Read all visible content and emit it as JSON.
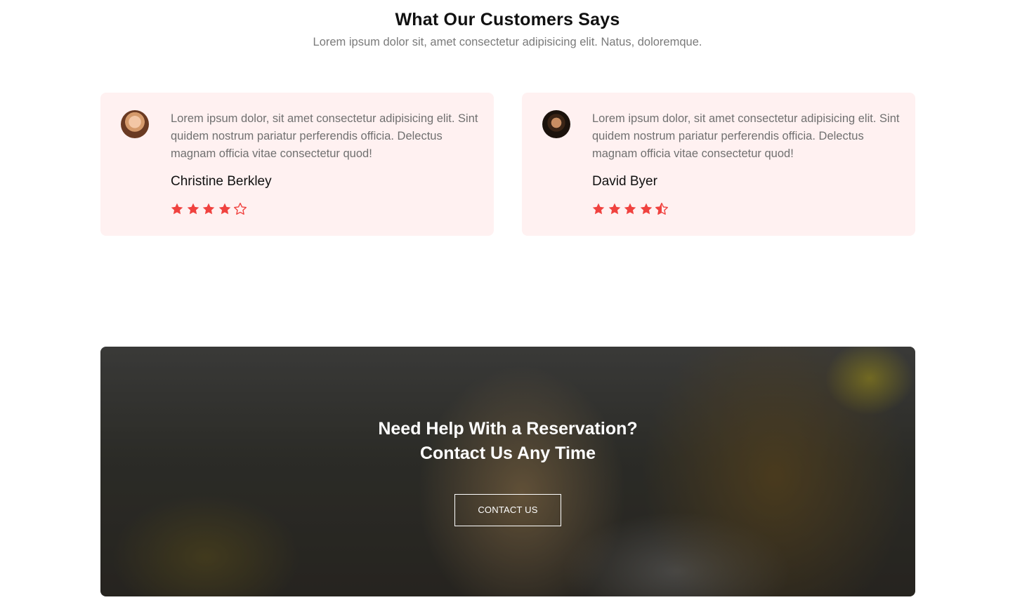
{
  "testimonials_section": {
    "title": "What Our Customers Says",
    "subtitle": "Lorem ipsum dolor sit, amet consectetur adipisicing elit. Natus, doloremque.",
    "items": [
      {
        "quote": "Lorem ipsum dolor, sit amet consectetur adipisicing elit. Sint quidem nostrum pariatur perferendis officia. Delectus magnam officia vitae consectetur quod!",
        "name": "Christine Berkley",
        "rating": 4,
        "stars": [
          "star-filled",
          "star-filled",
          "star-filled",
          "star-filled",
          "star-outline"
        ]
      },
      {
        "quote": "Lorem ipsum dolor, sit amet consectetur adipisicing elit. Sint quidem nostrum pariatur perferendis officia. Delectus magnam officia vitae consectetur quod!",
        "name": "David Byer",
        "rating": 4.5,
        "stars": [
          "star-filled",
          "star-filled",
          "star-filled",
          "star-filled",
          "star-half"
        ]
      }
    ]
  },
  "cta_banner": {
    "title_line1": "Need Help With a Reservation?",
    "title_line2": "Contact Us Any Time",
    "button_label": "CONTACT US"
  },
  "colors": {
    "accent_star": "#f0423f",
    "card_background": "#fff1f1",
    "title_text": "#111111",
    "body_text": "#707070"
  }
}
